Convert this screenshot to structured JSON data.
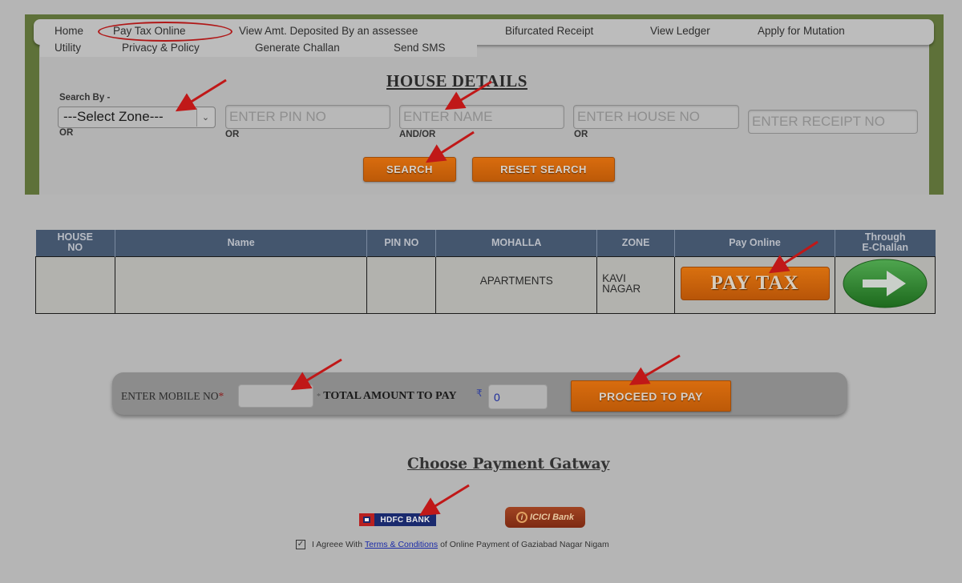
{
  "nav": {
    "row1": [
      "Home",
      "Pay Tax Online",
      "View Amt. Deposited By an assessee",
      "Bifurcated Receipt",
      "View Ledger",
      "Apply for Mutation"
    ],
    "row2": [
      "Utility",
      "Privacy & Policy",
      "Generate Challan",
      "Send SMS"
    ],
    "highlighted": "Pay Tax Online"
  },
  "search": {
    "title": "HOUSE DETAILS",
    "search_by_label": "Search By -",
    "zone_select": "---Select Zone---",
    "pin_placeholder": "ENTER PIN NO",
    "name_placeholder": "ENTER NAME",
    "house_placeholder": "ENTER HOUSE NO",
    "receipt_placeholder": "ENTER RECEIPT NO",
    "connectors": [
      "OR",
      "OR",
      "AND/OR",
      "OR"
    ],
    "search_button": "SEARCH",
    "reset_button": "RESET SEARCH"
  },
  "table": {
    "headers": [
      "HOUSE NO",
      "Name",
      "PIN NO",
      "MOHALLA",
      "ZONE",
      "Pay Online",
      "Through E-Challan"
    ],
    "header_lines": {
      "house_1": "HOUSE",
      "house_2": "NO",
      "echallan_1": "Through",
      "echallan_2": "E-Challan"
    },
    "rows": [
      {
        "house_no": "",
        "name": "",
        "pin_no": "",
        "mohalla": "APARTMENTS",
        "zone_1": "KAVI",
        "zone_2": "NAGAR",
        "pay_button": "PAY TAX",
        "echallan_icon": "arrow-right-icon"
      }
    ]
  },
  "payment": {
    "mobile_label": "ENTER MOBILE NO",
    "required_mark": "*",
    "mobile_value": "",
    "total_label": "TOTAL AMOUNT TO PAY",
    "currency_symbol": "₹",
    "amount_value": "0",
    "proceed_button": "PROCEED TO PAY"
  },
  "gateway": {
    "title": "Choose Payment Gatway",
    "banks": [
      "HDFC BANK",
      "ICICI Bank"
    ],
    "icici_text": "ICICI Bank",
    "hdfc_text": "HDFC BANK"
  },
  "agreement": {
    "checked": true,
    "prefix": "I Agreee With",
    "link": "Terms & Conditions",
    "suffix": "of Online Payment of Gaziabad Nagar Nigam"
  },
  "colors": {
    "frame_green": "#5e7139",
    "button_orange": "#c8620c",
    "table_header": "#44566e",
    "annotation_red": "#c01818"
  }
}
